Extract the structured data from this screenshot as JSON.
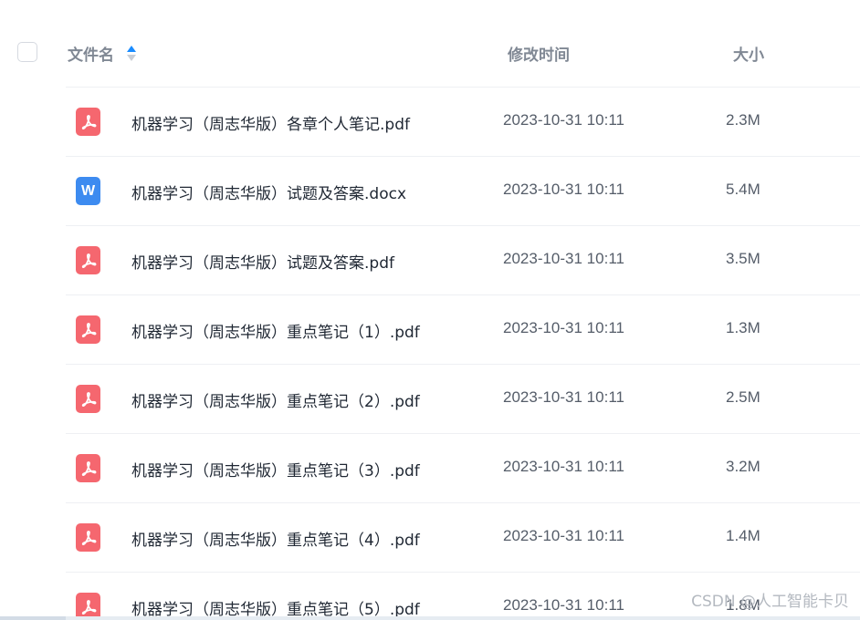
{
  "header": {
    "name_label": "文件名",
    "time_label": "修改时间",
    "size_label": "大小"
  },
  "files": [
    {
      "name": "机器学习（周志华版）各章个人笔记.pdf",
      "type": "pdf",
      "modified": "2023-10-31 10:11",
      "size": "2.3M"
    },
    {
      "name": "机器学习（周志华版）试题及答案.docx",
      "type": "docx",
      "modified": "2023-10-31 10:11",
      "size": "5.4M"
    },
    {
      "name": "机器学习（周志华版）试题及答案.pdf",
      "type": "pdf",
      "modified": "2023-10-31 10:11",
      "size": "3.5M"
    },
    {
      "name": "机器学习（周志华版）重点笔记（1）.pdf",
      "type": "pdf",
      "modified": "2023-10-31 10:11",
      "size": "1.3M"
    },
    {
      "name": "机器学习（周志华版）重点笔记（2）.pdf",
      "type": "pdf",
      "modified": "2023-10-31 10:11",
      "size": "2.5M"
    },
    {
      "name": "机器学习（周志华版）重点笔记（3）.pdf",
      "type": "pdf",
      "modified": "2023-10-31 10:11",
      "size": "3.2M"
    },
    {
      "name": "机器学习（周志华版）重点笔记（4）.pdf",
      "type": "pdf",
      "modified": "2023-10-31 10:11",
      "size": "1.4M"
    },
    {
      "name": "机器学习（周志华版）重点笔记（5）.pdf",
      "type": "pdf",
      "modified": "2023-10-31 10:11",
      "size": "1.8M"
    }
  ],
  "icons": {
    "pdf": "pdf-file-icon",
    "docx": "word-file-icon",
    "docx_letter": "W"
  },
  "colors": {
    "pdf_icon": "#f5676f",
    "docx_icon": "#3d8bf0",
    "sort_active": "#1a8cff"
  },
  "watermark": "CSDN @人工智能卡贝"
}
